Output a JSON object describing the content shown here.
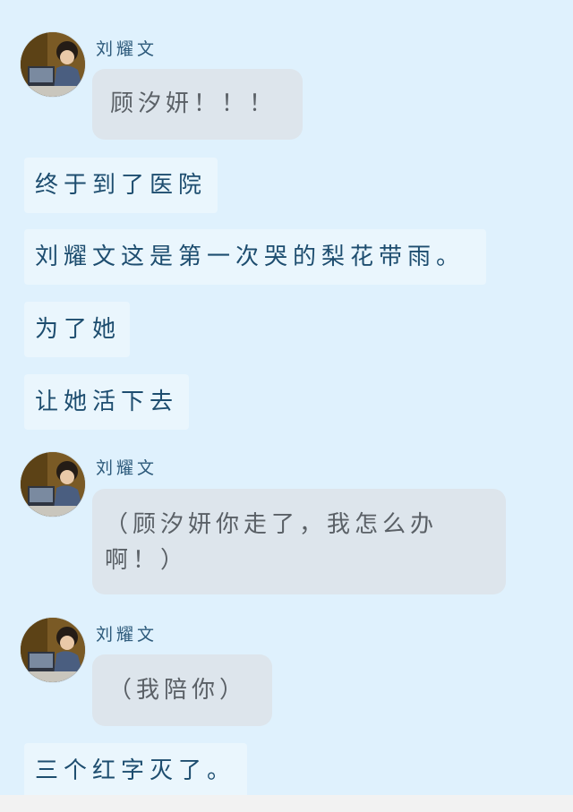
{
  "messages": [
    {
      "type": "chat",
      "name": "刘耀文",
      "avatar_icon": "avatar-photo-icon",
      "text": "顾汐妍！！！"
    },
    {
      "type": "narration",
      "text": "终于到了医院"
    },
    {
      "type": "narration",
      "text": "刘耀文这是第一次哭的梨花带雨。"
    },
    {
      "type": "narration",
      "text": "为了她"
    },
    {
      "type": "narration",
      "text": "让她活下去"
    },
    {
      "type": "chat",
      "name": "刘耀文",
      "avatar_icon": "avatar-photo-icon",
      "text_line1": "（顾汐妍你走了，我怎么办",
      "text_line2": "啊！）"
    },
    {
      "type": "chat",
      "name": "刘耀文",
      "avatar_icon": "avatar-photo-icon",
      "text": "（我陪你）"
    },
    {
      "type": "narration",
      "text": "三个红字灭了。"
    }
  ],
  "colors": {
    "background": "#dff1fd",
    "bubble": "#dde5ec",
    "narration": "#eaf6fd",
    "text": "#1d4d6f"
  }
}
